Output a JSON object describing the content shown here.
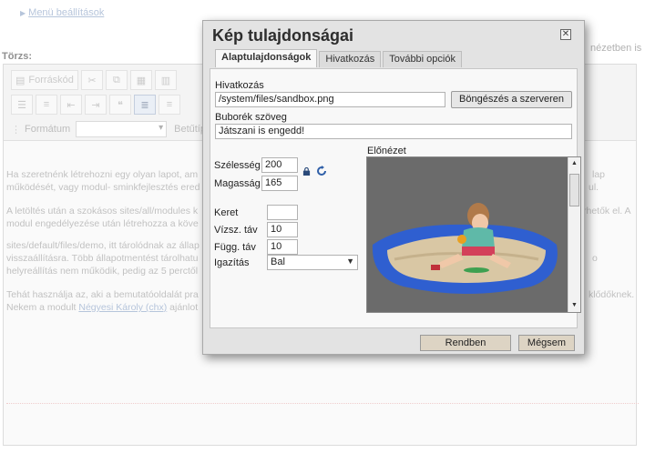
{
  "background": {
    "menu_link": "Menü beállítások",
    "torzs_label": "Törzs:",
    "right_fragment": "nézetben is",
    "toolbar": {
      "source_button": "Forráskód",
      "format_label": "Formátum",
      "font_label": "Betűtíp"
    },
    "content": {
      "line1": "Ha szeretnénk létrehozni egy olyan lapot, am",
      "line1_end": "lap",
      "line2": "működését, vagy modul- sminkfejlesztés ered",
      "line2_end": "ul.",
      "line3": "A letöltés után a szokásos sites/all/modules k",
      "line3_end": "rhetők el. A",
      "line4": "modul engedélyezése után létrehozza a köve",
      "line5": "sites/default/files/demo, itt tárolódnak az állap",
      "line6": "visszaállításra. Több állapotmentést tárolhatu",
      "line6_end": "o",
      "line7": "helyreállítás nem működik, pedig az 5 perctől",
      "line8": "Tehát használja az, aki a bemutatóoldalát pra",
      "line8_end": "klődőknek.",
      "line9_pre": "Nekem a modult ",
      "line9_link": "Négyesi Károly (chx)",
      "line9_post": " ajánlot"
    }
  },
  "dialog": {
    "title": "Kép tulajdonságai",
    "tabs": [
      {
        "label": "Alaptulajdonságok",
        "active": true
      },
      {
        "label": "Hivatkozás",
        "active": false
      },
      {
        "label": "További opciók",
        "active": false
      }
    ],
    "url_label": "Hivatkozás",
    "url_value": "/system/files/sandbox.png",
    "browse_button": "Böngészés a szerveren",
    "alt_label": "Buborék szöveg",
    "alt_value": "Játszani is engedd!",
    "width_label": "Szélesség",
    "width_value": "200",
    "height_label": "Magasság",
    "height_value": "165",
    "border_label": "Keret",
    "border_value": "",
    "hspace_label": "Vízsz. táv",
    "hspace_value": "10",
    "vspace_label": "Függ. táv",
    "vspace_value": "10",
    "align_label": "Igazítás",
    "align_value": "Bal",
    "preview_label": "Előnézet",
    "ok_button": "Rendben",
    "cancel_button": "Mégsem"
  },
  "colors": {
    "link": "#8fa6c8",
    "pool_blue": "#2f5fd0",
    "dialog_bg": "#e3e3e3"
  }
}
